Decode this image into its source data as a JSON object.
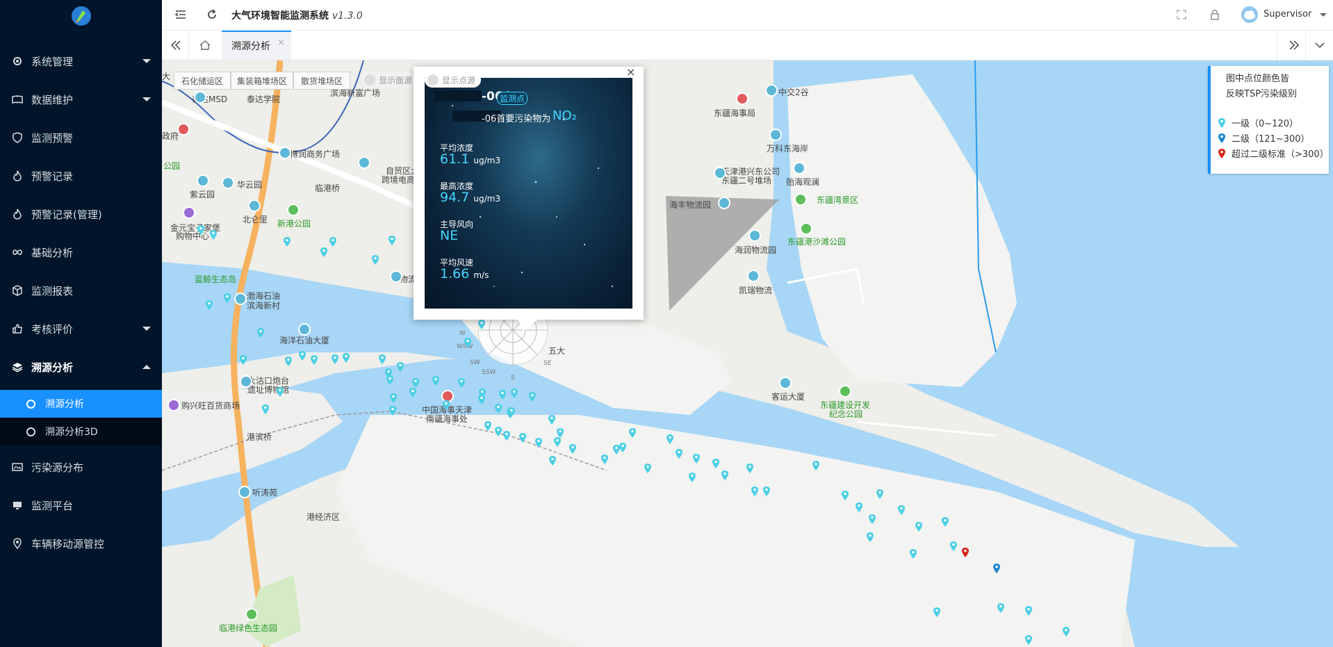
{
  "app": {
    "title": "大气环境智能监测系统",
    "version": "v1.3.0",
    "user": "Supervisor"
  },
  "sidebar": {
    "items": [
      {
        "label": "系统管理",
        "icon": "gear-icon"
      },
      {
        "label": "数据维护",
        "icon": "book-icon"
      },
      {
        "label": "监测预警",
        "icon": "shield-icon"
      },
      {
        "label": "预警记录",
        "icon": "fire-icon"
      },
      {
        "label": "预警记录(管理)",
        "icon": "fire-icon"
      },
      {
        "label": "基础分析",
        "icon": "infinity-icon"
      },
      {
        "label": "监测报表",
        "icon": "cube-icon"
      },
      {
        "label": "考核评价",
        "icon": "thumbs-up-icon"
      },
      {
        "label": "溯源分析",
        "icon": "layers-icon"
      },
      {
        "label": "污染源分布",
        "icon": "image-icon"
      },
      {
        "label": "监测平台",
        "icon": "monitor-icon"
      },
      {
        "label": "车辆移动源管控",
        "icon": "location-icon"
      }
    ],
    "subitems": [
      {
        "label": "溯源分析"
      },
      {
        "label": "溯源分析3D"
      }
    ]
  },
  "tabs": {
    "active_label": "溯源分析",
    "close": "×"
  },
  "map_controls": {
    "segments": [
      "石化储运区",
      "集装箱堆场区",
      "散货堆场区"
    ],
    "toggle_area": "显示面源",
    "toggle_point": "显示点源"
  },
  "legend": {
    "title_line1": "图中点位颜色皆",
    "title_line2": "反映TSP污染级别",
    "levels": [
      {
        "label": "一级（0~120）",
        "color": "#4ccfe6"
      },
      {
        "label": "二级（121~300）",
        "color": "#1e88d0"
      },
      {
        "label": "超过二级标准（>300）",
        "color": "#d8261c"
      }
    ]
  },
  "popup": {
    "station_suffix": "-06",
    "badge": "监测点",
    "pollutant_prefix": "-06首要污染物为",
    "pollutant": "NO₂",
    "metrics": [
      {
        "label": "平均浓度",
        "value": "61.1",
        "unit": "ug/m3"
      },
      {
        "label": "最高浓度",
        "value": "94.7",
        "unit": "ug/m3"
      },
      {
        "label": "主导风向",
        "value": "NE",
        "unit": ""
      },
      {
        "label": "平均风速",
        "value": "1.66",
        "unit": "m/s"
      }
    ],
    "close": "×"
  },
  "compass": {
    "labels": [
      "W",
      "WSW",
      "SW",
      "SSW",
      "S",
      "SE"
    ]
  },
  "map_labels": [
    "泰达MSD",
    "泰达学院",
    "滨海新富广场",
    "博润商务广场",
    "自贸区大",
    "跨境电商",
    "华云园",
    "紫云园",
    "北仑里",
    "临港桥",
    "新港公园",
    "金元宝子家堡",
    "购物中心",
    "渤海石油",
    "滨海新村",
    "蓝鲸生态岛",
    "海洋石油大厦",
    "大沽口炮台",
    "遗址博物馆",
    "购兴旺百货商场",
    "中国海事天津",
    "南疆海事处",
    "港滨桥",
    "听涛苑",
    "港经济区",
    "临港绿色生态园",
    "中交2谷",
    "东疆海事局",
    "万科东海岸",
    "天津港兴东公司",
    "东疆二号堆场",
    "贻海观澜",
    "东疆湾景区",
    "海丰物流园",
    "东疆港沙滩公园",
    "海润物流园",
    "凯瑞物流",
    "客运大厦",
    "东疆建设开发",
    "纪念公园",
    "公园",
    "政府",
    "大",
    "五大",
    "物流",
    "跨境电商"
  ],
  "monitor_points": [
    {
      "lng": 117.601,
      "lat": 39.03,
      "level": 1
    }
  ]
}
